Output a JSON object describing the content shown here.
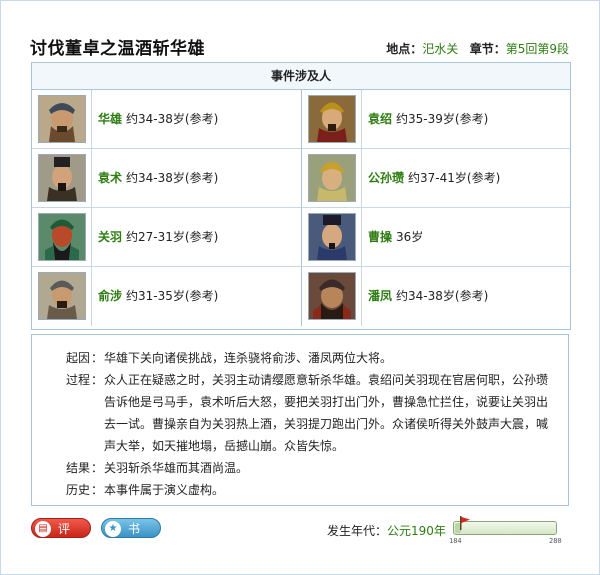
{
  "title": "讨伐董卓之温酒斩华雄",
  "meta": {
    "location_label": "地点：",
    "location_value": "汜水关",
    "chapter_label": "章节：",
    "chapter_value": "第5回第9段"
  },
  "people": {
    "header": "事件涉及人",
    "list": [
      {
        "name": "华雄",
        "age": "约34-38岁(参考)"
      },
      {
        "name": "袁绍",
        "age": "约35-39岁(参考)"
      },
      {
        "name": "袁术",
        "age": "约34-38岁(参考)"
      },
      {
        "name": "公孙瓒",
        "age": "约37-41岁(参考)"
      },
      {
        "name": "关羽",
        "age": "约27-31岁(参考)"
      },
      {
        "name": "曹操",
        "age": "36岁"
      },
      {
        "name": "俞涉",
        "age": "约31-35岁(参考)"
      },
      {
        "name": "潘凤",
        "age": "约34-38岁(参考)"
      }
    ]
  },
  "story": {
    "sep": "：",
    "cause_label": "起因",
    "cause": "华雄下关向诸侯挑战，连杀骁将俞涉、潘凤两位大将。",
    "process_label": "过程",
    "process": "众人正在疑惑之时，关羽主动请缨愿意斩杀华雄。袁绍问关羽现在官居何职，公孙瓒告诉他是弓马手，袁术听后大怒，要把关羽打出门外，曹操急忙拦住，说要让关羽出去一试。曹操亲自为关羽热上酒，关羽提刀跑出门外。众诸侯听得关外鼓声大震，喊声大举，如天摧地塌，岳撼山崩。众皆失惊。",
    "result_label": "结果",
    "result": "关羽斩杀华雄而其酒尚温。",
    "history_label": "历史",
    "history": "本事件属于演义虚构。"
  },
  "buttons": {
    "comment_label": "评论",
    "bookmark_label": "书签"
  },
  "era": {
    "label": "发生年代：",
    "value": "公元190年",
    "timeline_min": "184",
    "timeline_max": "280",
    "timeline_progress": 0.06
  }
}
